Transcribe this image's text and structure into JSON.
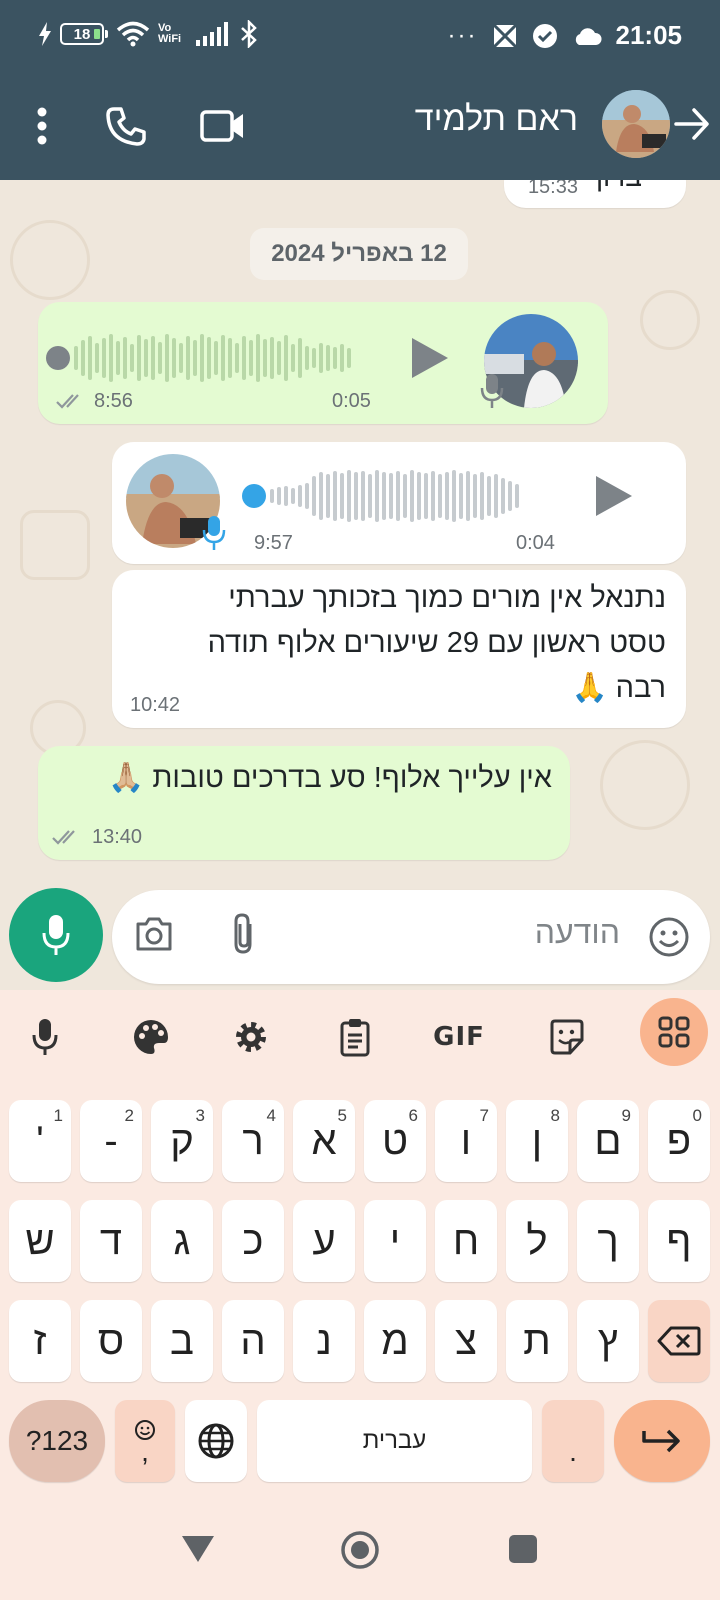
{
  "status_bar": {
    "battery": "18",
    "vowifi": "Vo WiFi",
    "overflow": "···",
    "time": "21:05"
  },
  "header": {
    "contact_name": "ראם תלמיד"
  },
  "chat": {
    "prev_message_time": "15:33",
    "prev_message_fragment": "ברוך",
    "date_chip": "12 באפריל 2024",
    "voice_out": {
      "duration": "0:05",
      "time": "8:56",
      "status": "read"
    },
    "voice_in": {
      "duration": "0:04",
      "time": "9:57"
    },
    "text_in": {
      "lines": [
        "נתנאל אין מורים כמוך בזכותך עברתי",
        "טסט ראשון עם 29 שיעורים אלוף תודה",
        "רבה 🙏"
      ],
      "time": "10:42"
    },
    "text_out": {
      "text": "אין עלייך אלוף! סע בדרכים טובות 🙏🏼",
      "time": "13:40",
      "status": "read"
    }
  },
  "composer": {
    "placeholder": "הודעה"
  },
  "keyboard": {
    "toolbar": {
      "gif": "GIF"
    },
    "row1": [
      {
        "label": "פ",
        "num": "0"
      },
      {
        "label": "ם",
        "num": "9"
      },
      {
        "label": "ן",
        "num": "8"
      },
      {
        "label": "ו",
        "num": "7"
      },
      {
        "label": "ט",
        "num": "6"
      },
      {
        "label": "א",
        "num": "5"
      },
      {
        "label": "ר",
        "num": "4"
      },
      {
        "label": "ק",
        "num": "3"
      },
      {
        "label": "-",
        "num": "2"
      },
      {
        "label": "'",
        "num": "1"
      }
    ],
    "row2": [
      "ף",
      "ך",
      "ל",
      "ח",
      "י",
      "ע",
      "כ",
      "ג",
      "ד",
      "ש"
    ],
    "row3": [
      "ץ",
      "ת",
      "צ",
      "מ",
      "נ",
      "ה",
      "ב",
      "ס",
      "ז"
    ],
    "sym_label": "?123",
    "comma": ",",
    "space_label": "עברית",
    "period": "."
  }
}
